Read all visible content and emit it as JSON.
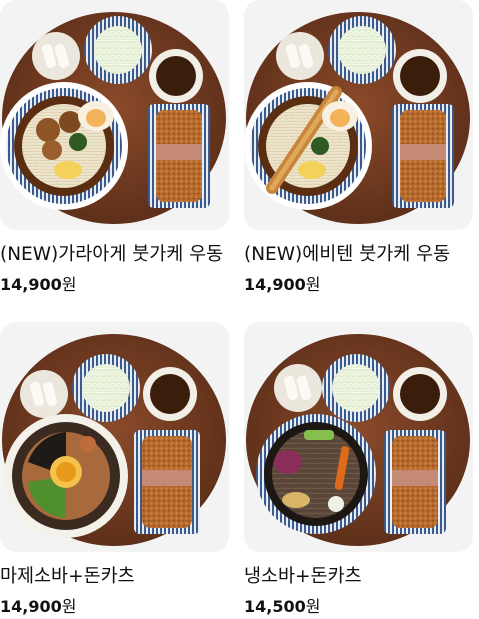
{
  "products": [
    {
      "name": "(NEW)가라아게 붓가케 우동",
      "price": "14,900",
      "currency": "원",
      "image_icon": "karaage-udon-set-photo"
    },
    {
      "name": "(NEW)에비텐 붓가케 우동",
      "price": "14,900",
      "currency": "원",
      "image_icon": "ebiten-udon-set-photo"
    },
    {
      "name": "마제소바+돈카츠",
      "price": "14,900",
      "currency": "원",
      "image_icon": "mazesoba-tonkatsu-set-photo"
    },
    {
      "name": "냉소바+돈카츠",
      "price": "14,500",
      "currency": "원",
      "image_icon": "cold-soba-tonkatsu-set-photo"
    }
  ]
}
